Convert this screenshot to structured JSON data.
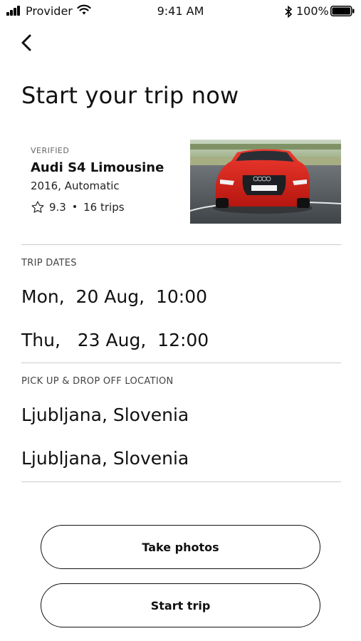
{
  "status_bar": {
    "carrier": "Provider",
    "time": "9:41 AM",
    "battery": "100%"
  },
  "header": {
    "title": "Start your trip now"
  },
  "car": {
    "badge": "VERIFIED",
    "name": "Audi S4 Limousine",
    "details": "2016, Automatic",
    "rating": "9.3",
    "trips": "16 trips",
    "separator": "•",
    "color": "#d9241d"
  },
  "trip_dates": {
    "label": "TRIP DATES",
    "start": "Mon,  20 Aug,  10:00",
    "end": "Thu,   23 Aug,  12:00"
  },
  "location": {
    "label": "PICK UP & DROP OFF LOCATION",
    "pickup": "Ljubljana, Slovenia",
    "dropoff": "Ljubljana, Slovenia"
  },
  "actions": {
    "take_photos": "Take photos",
    "start_trip": "Start trip"
  },
  "icons": {
    "back": "chevron-left-icon",
    "star": "star-outline-icon",
    "wifi": "wifi-icon",
    "bluetooth": "bluetooth-icon",
    "battery": "battery-icon",
    "signal": "signal-icon"
  }
}
